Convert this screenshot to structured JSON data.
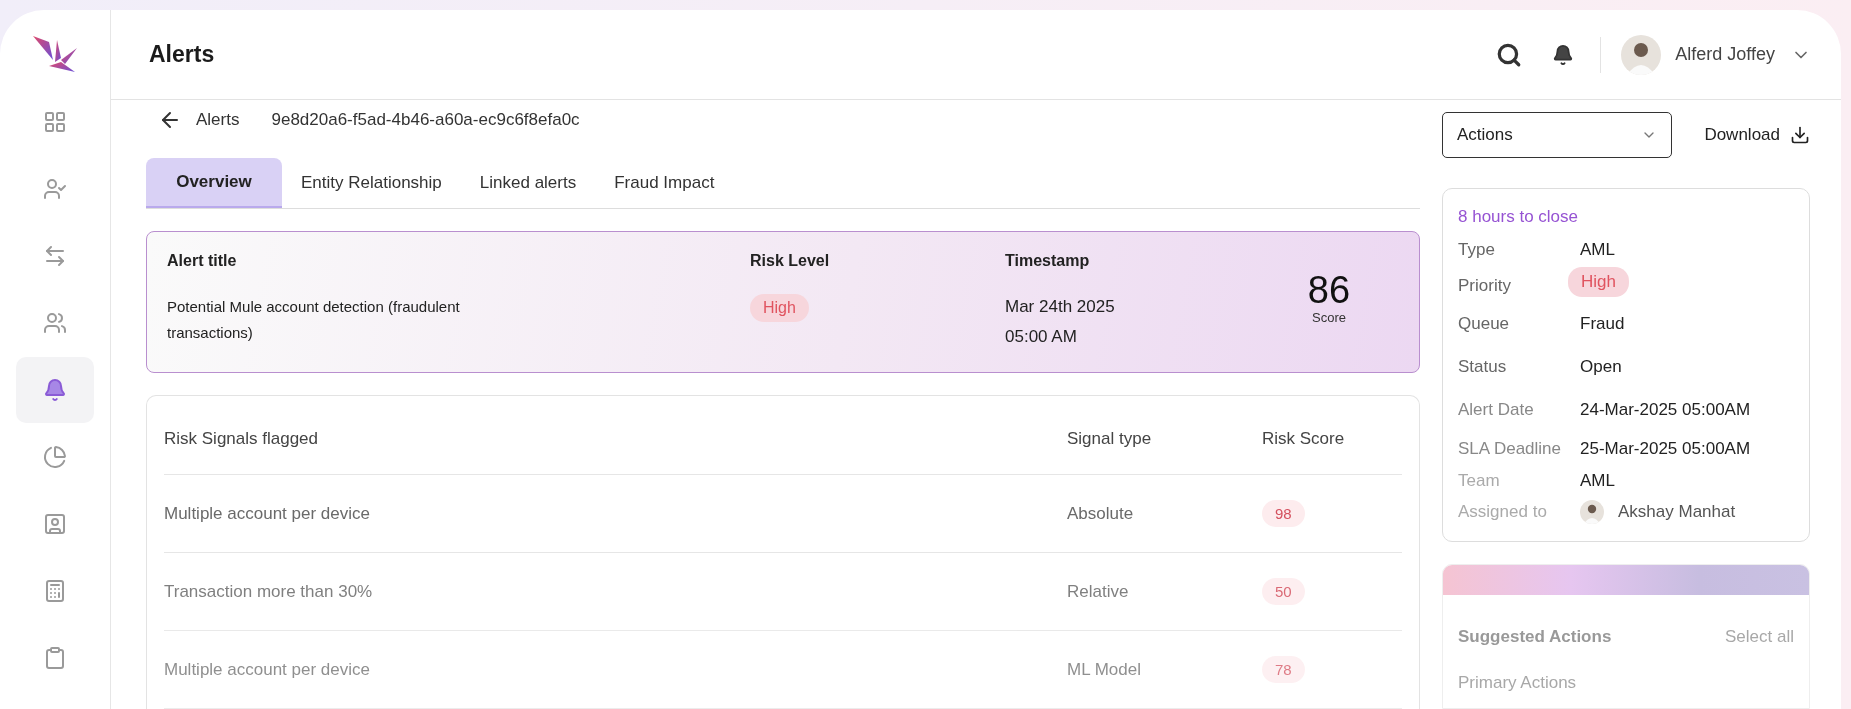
{
  "sidebar": {
    "items": [
      {
        "selected": false
      },
      {
        "selected": false
      },
      {
        "selected": false
      },
      {
        "selected": false
      },
      {
        "selected": true
      },
      {
        "selected": false
      },
      {
        "selected": false
      },
      {
        "selected": false
      },
      {
        "selected": false
      }
    ]
  },
  "header": {
    "title": "Alerts",
    "user": {
      "name": "Alferd Joffey"
    }
  },
  "breadcrumb": {
    "back": "Alerts",
    "alert_id": "9e8d20a6-f5ad-4b46-a60a-ec9c6f8efa0c"
  },
  "actions": {
    "dropdown": "Actions",
    "download": "Download"
  },
  "tabs": [
    {
      "label": "Overview",
      "selected": true
    },
    {
      "label": "Entity Relationship",
      "selected": false
    },
    {
      "label": "Linked alerts",
      "selected": false
    },
    {
      "label": "Fraud Impact",
      "selected": false
    }
  ],
  "alert_summary": {
    "title_label": "Alert title",
    "title": "Potential Mule account detection (fraudulent transactions)",
    "risk_label": "Risk Level",
    "risk": "High",
    "timestamp_label": "Timestamp",
    "date": "Mar 24th  2025",
    "time": "05:00 AM",
    "score": "86",
    "score_label": "Score"
  },
  "signals_table": {
    "columns": [
      "Risk Signals flagged",
      "Signal type",
      "Risk Score"
    ],
    "rows": [
      {
        "signal": "Multiple account per device",
        "type": "Absolute",
        "score": "98"
      },
      {
        "signal": "Transaction more than 30%",
        "type": "Relative",
        "score": "50"
      },
      {
        "signal": "Multiple account per device",
        "type": "ML Model",
        "score": "78"
      }
    ]
  },
  "details": {
    "countdown": "8 hours to close",
    "rows": [
      {
        "label": "Type",
        "value": "AML",
        "kind": "text"
      },
      {
        "label": "Priority",
        "value": "High",
        "kind": "badge"
      },
      {
        "label": "Queue",
        "value": "Fraud",
        "kind": "text"
      },
      {
        "label": "Status",
        "value": "Open",
        "kind": "text"
      },
      {
        "label": "Alert Date",
        "value": "24-Mar-2025 05:00AM",
        "kind": "text"
      },
      {
        "label": "SLA Deadline",
        "value": "25-Mar-2025 05:00AM",
        "kind": "text"
      },
      {
        "label": "Team",
        "value": "AML",
        "kind": "text"
      },
      {
        "label": "Assigned to",
        "value": "Akshay Manhat",
        "kind": "avatar"
      }
    ]
  },
  "suggested_actions": {
    "title": "Suggested Actions",
    "select_all": "Select all",
    "section": "Primary Actions"
  }
}
